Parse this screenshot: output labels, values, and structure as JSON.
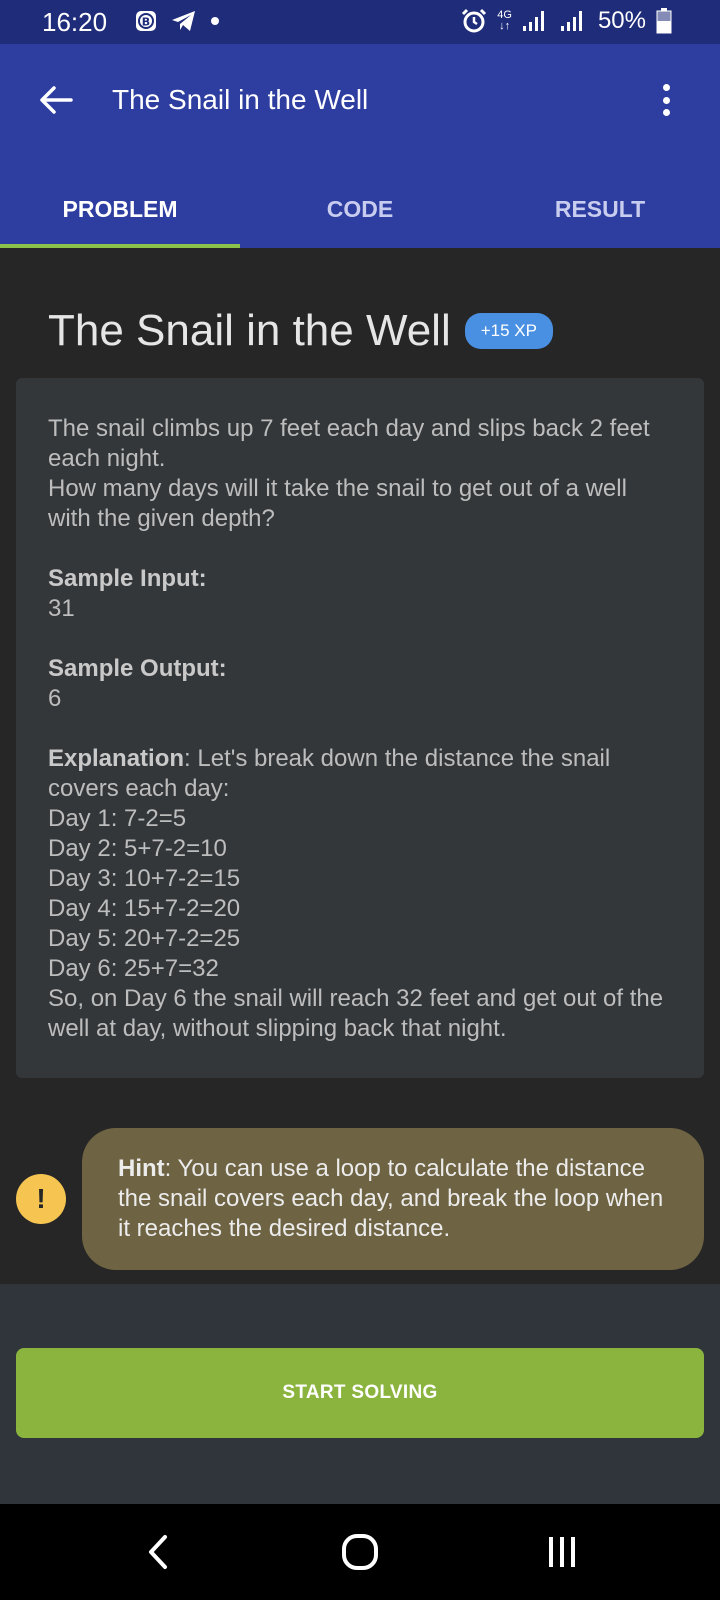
{
  "status_bar": {
    "time": "16:20",
    "battery": "50%",
    "network": "4G"
  },
  "app_bar": {
    "title": "The Snail in the Well",
    "tabs": [
      {
        "label": "PROBLEM",
        "active": true
      },
      {
        "label": "CODE",
        "active": false
      },
      {
        "label": "RESULT",
        "active": false
      }
    ]
  },
  "problem": {
    "title": "The Snail in the Well",
    "xp_badge": "+15 XP",
    "description_line1": "The snail climbs up 7 feet each day and slips back 2 feet each night.",
    "description_line2": "How many days will it take the snail to get out of a well with the given depth?",
    "sample_input_label": "Sample Input:",
    "sample_input": "31",
    "sample_output_label": "Sample Output:",
    "sample_output": "6",
    "explanation_label": "Explanation",
    "explanation_intro": ": Let's break down the distance the snail covers each day:",
    "days": [
      "Day 1: 7-2=5",
      "Day 2: 5+7-2=10",
      "Day 3: 10+7-2=15",
      "Day 4: 15+7-2=20",
      "Day 5: 20+7-2=25",
      "Day 6: 25+7=32"
    ],
    "conclusion": "So, on Day 6 the snail will reach 32 feet and get out of the well at day, without slipping back that night."
  },
  "hint": {
    "label": "Hint",
    "text": ": You can use a loop to calculate the distance the snail covers each day, and break the loop when it reaches the desired distance."
  },
  "action": {
    "start_label": "START SOLVING"
  },
  "colors": {
    "app_bar": "#2e3da0",
    "status_bar": "#1f2c7a",
    "tab_indicator": "#8bc34a",
    "xp_badge": "#4a90e2",
    "start_button": "#8bb43f",
    "hint_bubble": "#6e6342",
    "hint_icon": "#f5c451"
  },
  "icons": {
    "back": "arrow-left-icon",
    "more": "more-vertical-icon",
    "hint": "exclamation-icon",
    "nav_back": "chevron-left-icon",
    "nav_home": "home-circle-icon",
    "nav_recents": "recents-icon"
  }
}
